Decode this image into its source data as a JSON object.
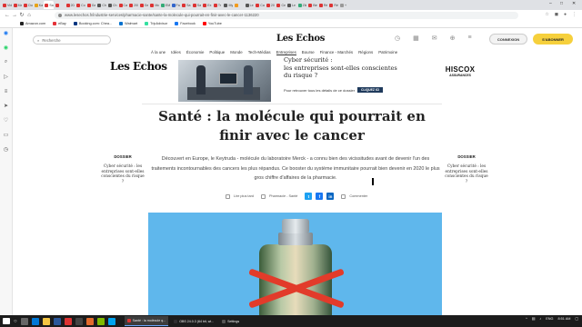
{
  "browser": {
    "tabs": [
      {
        "label": "Vidé",
        "color": "#d33"
      },
      {
        "label": "Ma v",
        "color": "#d33"
      },
      {
        "label": "Duc",
        "color": "#d33"
      },
      {
        "label": "Kaf",
        "color": "#e8a317"
      },
      {
        "label": "Sa",
        "color": "#d33"
      },
      {
        "label": "",
        "color": "#d33"
      },
      {
        "label": "2022",
        "color": "#d33"
      },
      {
        "label": "Co",
        "color": "#d33"
      },
      {
        "label": "Ga",
        "color": "#d33"
      },
      {
        "label": "Ch",
        "color": "#555"
      },
      {
        "label": "Ch",
        "color": "#555"
      },
      {
        "label": "Ca",
        "color": "#d33"
      },
      {
        "label": "200",
        "color": "#d33"
      },
      {
        "label": "Ge",
        "color": "#d33"
      },
      {
        "label": "Mc",
        "color": "#d33"
      },
      {
        "label": "EM",
        "color": "#3a7"
      },
      {
        "label": "Fa",
        "color": "#36c"
      },
      {
        "label": "Sa",
        "color": "#d33"
      },
      {
        "label": "Sa",
        "color": "#d33"
      },
      {
        "label": "Ex",
        "color": "#d33"
      },
      {
        "label": "Tr",
        "color": "#d33"
      },
      {
        "label": "My",
        "color": "#555"
      },
      {
        "label": "",
        "color": "#f29b1d"
      },
      {
        "label": "Le",
        "color": "#555"
      },
      {
        "label": "Ca",
        "color": "#d33"
      },
      {
        "label": "200",
        "color": "#d33"
      },
      {
        "label": "Ce",
        "color": "#d33"
      },
      {
        "label": "Le",
        "color": "#555"
      },
      {
        "label": "Zik",
        "color": "#3a7"
      },
      {
        "label": "Bin",
        "color": "#d33"
      },
      {
        "label": "Ré",
        "color": "#d33"
      },
      {
        "label": "Ré",
        "color": "#d33"
      },
      {
        "label": "+",
        "color": "#999"
      }
    ],
    "active_tab_index": 4,
    "url": "www.lesechos.fr/industrie-services/pharmacie-sante/sante-la-molecule-qui-pourrait-en-finir-avec-le-cancer-1136220",
    "bookmarks": [
      {
        "label": "Amazon.com",
        "color": "#222"
      },
      {
        "label": "eBay",
        "color": "#e53238"
      },
      {
        "label": "Booking.com: Chea...",
        "color": "#003580"
      },
      {
        "label": "Walmart",
        "color": "#0071ce"
      },
      {
        "label": "TripAdvisor",
        "color": "#34e0a1"
      },
      {
        "label": "Facebook",
        "color": "#1877f2"
      },
      {
        "label": "YouTube",
        "color": "#ff0000"
      }
    ]
  },
  "site": {
    "search_placeholder": "Recherche",
    "logo": "Les Echos",
    "connexion_label": "CONNEXION",
    "abonner_label": "S'ABONNER",
    "menu": [
      "À la une",
      "Idées",
      "Économie",
      "Politique",
      "Monde",
      "Tech-Médias",
      "Entreprises",
      "Bourse",
      "Finance - Marchés",
      "Régions",
      "Patrimoine"
    ],
    "menu_active_index": 6
  },
  "ad": {
    "title_line1": "Cyber sécurité :",
    "title_line2": "les entreprises sont-elles conscientes",
    "title_line3": "du risque ?",
    "subtitle": "Pour retrouver tous les détails de ce dossier",
    "cta": "CLIQUEZ ICI",
    "brand": "HISCOX",
    "brand_sub": "ASSURANCES"
  },
  "article": {
    "headline": "Santé : la molécule qui pourrait en finir avec le cancer",
    "chapo": "Découvert en Europe, le Keytruda - molécule du laboratoire Merck - a connu bien des vicissitudes avant de devenir l'un des traitements incontournables des cancers les plus répandus. Ce booster du système immunitaire pourrait bien devenir en 2020 le plus gros chiffre d'affaires de la pharmacie.",
    "read_later": "Lire plus tard",
    "category": "Pharmacie - Santé",
    "comment": "Commenter"
  },
  "sidebar_left": {
    "kicker": "DOSSIER",
    "text": "Cyber sécurité : les entreprises sont-elles conscientes du risque ?"
  },
  "sidebar_right": {
    "kicker": "DOSSIER",
    "text": "Cyber sécurité : les entreprises sont-elles conscientes du risque ?"
  },
  "taskbar": {
    "items": [
      {
        "label": "Santé : la molécule q...",
        "color": "#d33",
        "active": true
      },
      {
        "label": "OBS 24.0.3 (64 bit, wi...",
        "color": "#302e31",
        "active": false
      },
      {
        "label": "Settings",
        "color": "#555",
        "active": false
      }
    ],
    "lang": "ENG",
    "time": "8:51 AM"
  }
}
